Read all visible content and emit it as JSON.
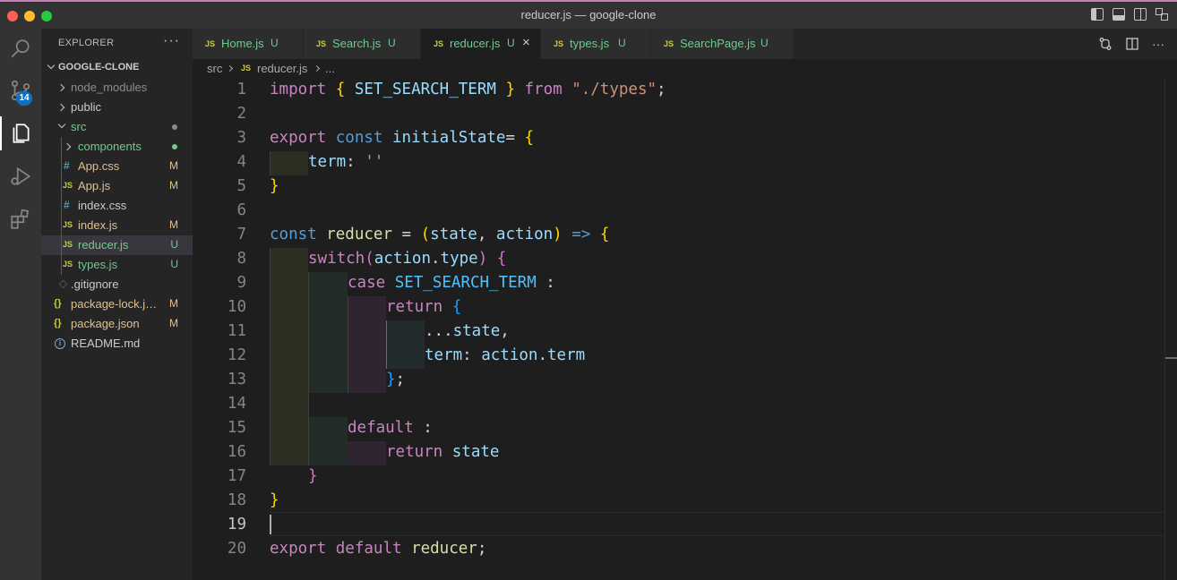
{
  "window": {
    "title": "reducer.js — google-clone"
  },
  "activity": {
    "scm_badge": "14"
  },
  "explorer": {
    "header": "EXPLORER",
    "more": "···",
    "project": "GOOGLE-CLONE",
    "items": [
      {
        "label": "node_modules",
        "status": ""
      },
      {
        "label": "public",
        "status": ""
      },
      {
        "label": "src",
        "status": ""
      },
      {
        "label": "components",
        "status": ""
      },
      {
        "icon": "#",
        "label": "App.css",
        "status": "M"
      },
      {
        "icon": "JS",
        "label": "App.js",
        "status": "M"
      },
      {
        "icon": "#",
        "label": "index.css",
        "status": ""
      },
      {
        "icon": "JS",
        "label": "index.js",
        "status": "M"
      },
      {
        "icon": "JS",
        "label": "reducer.js",
        "status": "U"
      },
      {
        "icon": "JS",
        "label": "types.js",
        "status": "U"
      },
      {
        "icon": "",
        "label": ".gitignore",
        "status": ""
      },
      {
        "icon": "{}",
        "label": "package-lock.json",
        "status": "M"
      },
      {
        "icon": "{}",
        "label": "package.json",
        "status": "M"
      },
      {
        "icon": "i",
        "label": "README.md",
        "status": ""
      }
    ]
  },
  "tabs": [
    {
      "icon": "JS",
      "label": "Home.js",
      "status": "U"
    },
    {
      "icon": "JS",
      "label": "Search.js",
      "status": "U"
    },
    {
      "icon": "JS",
      "label": "reducer.js",
      "status": "U",
      "close": "×"
    },
    {
      "icon": "JS",
      "label": "types.js",
      "status": "U"
    },
    {
      "icon": "JS",
      "label": "SearchPage.js",
      "status": "U"
    }
  ],
  "breadcrumb": {
    "folder": "src",
    "icon": "JS",
    "file": "reducer.js",
    "more": "..."
  },
  "editor": {
    "line_numbers": [
      "1",
      "2",
      "3",
      "4",
      "5",
      "6",
      "7",
      "8",
      "9",
      "10",
      "11",
      "12",
      "13",
      "14",
      "15",
      "16",
      "17",
      "18",
      "19",
      "20"
    ],
    "tokens": {
      "l1": [
        "import",
        " ",
        "{",
        " SET_SEARCH_TERM ",
        "}",
        " from ",
        "\"./types\"",
        ";"
      ],
      "l3": [
        "export",
        " ",
        "const",
        " ",
        "initialState",
        "= ",
        "{"
      ],
      "l4": [
        "term",
        ": ",
        "''"
      ],
      "l5": [
        "}"
      ],
      "l7": [
        "const",
        " ",
        "reducer",
        " = ",
        "(",
        "state",
        ", ",
        "action",
        ")",
        " ",
        "=>",
        " ",
        "{"
      ],
      "l8": [
        "switch",
        "(",
        "action",
        ".",
        "type",
        ")",
        " ",
        "{"
      ],
      "l9": [
        "case",
        " ",
        "SET_SEARCH_TERM",
        " :"
      ],
      "l10": [
        "return",
        " ",
        "{"
      ],
      "l11": [
        "...",
        "state",
        ","
      ],
      "l12": [
        "term",
        ": ",
        "action",
        ".",
        "term"
      ],
      "l13": [
        "}",
        ";"
      ],
      "l15": [
        "default",
        " :"
      ],
      "l16": [
        "return",
        " ",
        "state"
      ],
      "l17": [
        "}"
      ],
      "l18": [
        "}"
      ],
      "l20": [
        "export",
        " ",
        "default",
        " ",
        "reducer",
        ";"
      ]
    }
  }
}
